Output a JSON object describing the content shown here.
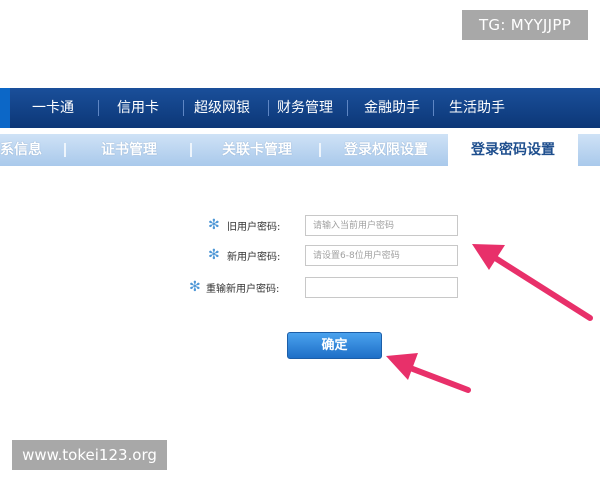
{
  "overlay": {
    "tg_tag": "TG: MYYJJPP",
    "watermark": "www.tokei123.org"
  },
  "topnav": {
    "items": [
      "一卡通",
      "信用卡",
      "超级网银",
      "财务管理",
      "金融助手",
      "生活助手"
    ]
  },
  "subnav": {
    "tabs": [
      "系信息",
      "证书管理",
      "关联卡管理",
      "登录权限设置",
      "登录密码设置"
    ],
    "active": "登录密码设置"
  },
  "form": {
    "required_mark": "✻",
    "old_password": {
      "label": "旧用户密码:",
      "placeholder": "请输入当前用户密码"
    },
    "new_password": {
      "label": "新用户密码:",
      "placeholder": "请设置6-8位用户密码"
    },
    "confirm_password": {
      "label": "重输新用户密码:",
      "placeholder": ""
    },
    "submit_label": "确定"
  },
  "colors": {
    "nav_bg": "#0c3777",
    "subnav_bg": "#a9c9eb",
    "arrow": "#e8306a",
    "button": "#1e6fc7"
  }
}
